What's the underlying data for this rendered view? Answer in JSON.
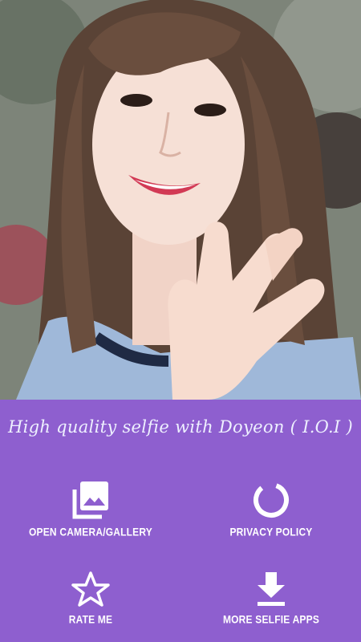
{
  "app": {
    "tagline": "High quality selfie with Doyeon ( I.O.I )"
  },
  "menu": {
    "open_camera_gallery": {
      "label": "OPEN CAMERA/GALLERY",
      "icon": "photo-library-icon"
    },
    "privacy_policy": {
      "label": "PRIVACY POLICY",
      "icon": "circle-progress-icon"
    },
    "rate_me": {
      "label": "RATE ME",
      "icon": "star-outline-icon"
    },
    "more_selfie_apps": {
      "label": "MORE SELFIE APPS",
      "icon": "download-icon"
    }
  },
  "colors": {
    "panel": "#8e5fcf",
    "text": "#ffffff"
  }
}
